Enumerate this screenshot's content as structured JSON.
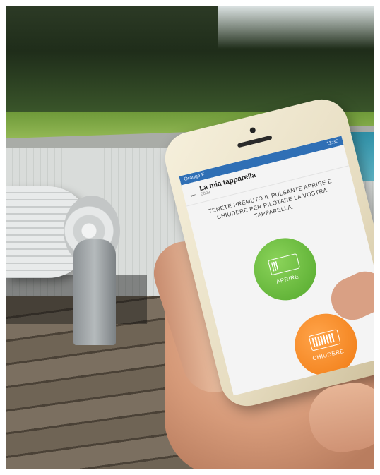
{
  "phone": {
    "status_carrier": "Orange F",
    "status_time": "11:30",
    "screen_title": "La mia tapparella",
    "screen_subtitle": "0009",
    "back_icon": "arrow-left-icon",
    "instruction": "TENETE PREMUTO IL PULSANTE APRIRE E CHIUDERE PER PILOTARE LA VOSTRA TAPPARELLA.",
    "open_button_label": "APRIRE",
    "close_button_label": "CHIUDERE"
  },
  "colors": {
    "statusbar": "#2f6fb5",
    "open_button": "#53a82c",
    "close_button": "#f07a12"
  }
}
